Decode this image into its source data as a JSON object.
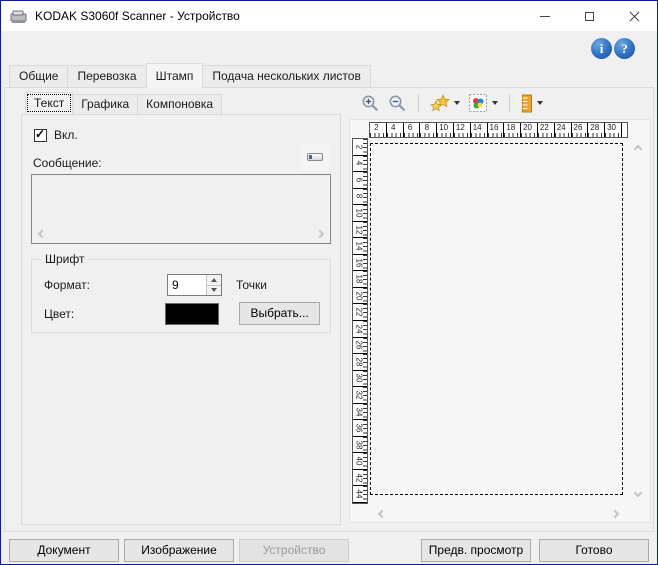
{
  "window": {
    "title": "KODAK S3060f Scanner - Устройство"
  },
  "tabs": {
    "items": [
      "Общие",
      "Перевозка",
      "Штамп",
      "Подача нескольких листов"
    ],
    "active": "Штамп"
  },
  "inner_tabs": {
    "items": [
      "Текст",
      "Графика",
      "Компоновка"
    ],
    "active": "Текст"
  },
  "text_tab": {
    "enable_label": "Вкл.",
    "enabled": true,
    "message_label": "Сообщение:",
    "message_value": "",
    "font_group": {
      "title": "Шрифт",
      "format_label": "Формат:",
      "format_value": "9",
      "format_units": "Точки",
      "color_label": "Цвет:",
      "color_value": "#000000",
      "choose_button_label": "Выбрать..."
    }
  },
  "preview": {
    "rulers": {
      "horizontal": [
        2,
        4,
        6,
        8,
        10,
        12,
        14,
        16,
        18,
        20,
        22,
        24,
        26,
        28,
        30
      ],
      "vertical": [
        2,
        4,
        6,
        8,
        10,
        12,
        14,
        16,
        18,
        20,
        22,
        24,
        26,
        28,
        30,
        32,
        34,
        36,
        38,
        40,
        42,
        44
      ]
    }
  },
  "footer": {
    "document": "Документ",
    "image": "Изображение",
    "device": "Устройство",
    "preview": "Предв. просмотр",
    "done": "Готово"
  },
  "colors": {
    "window_border": "#121c8d",
    "help_icon_blue": "#2f6fc0",
    "star_yellow": "#f2c33c",
    "ruler_orange": "#eda52f",
    "swatch_black": "#000000"
  }
}
